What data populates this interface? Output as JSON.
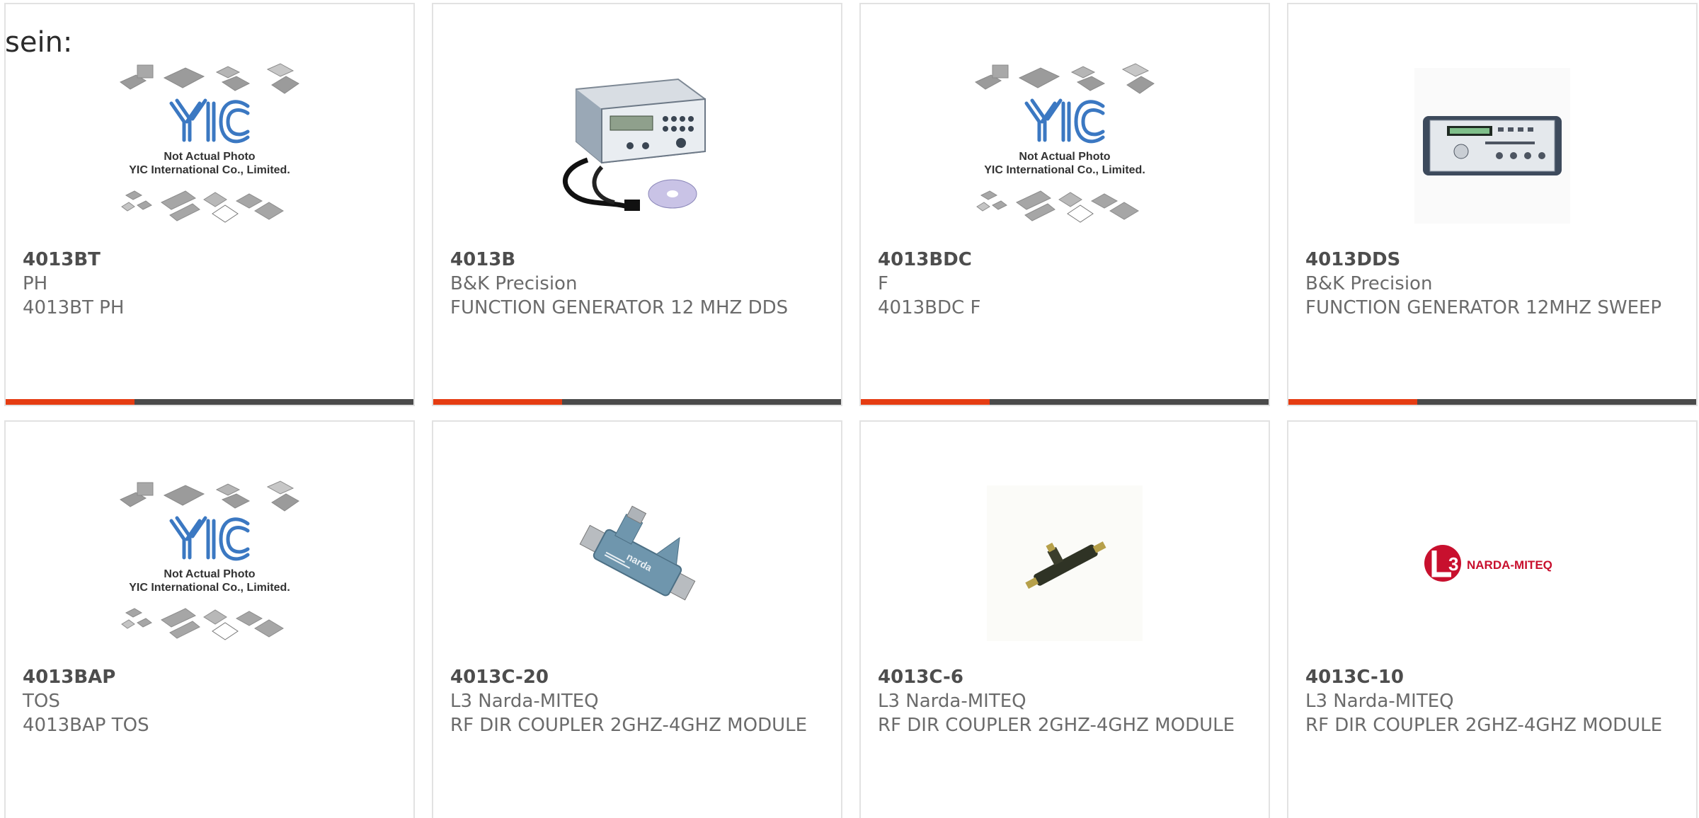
{
  "heading": "sein:",
  "colors": {
    "accent": "#e53c12",
    "bar": "#4a4a4a",
    "border": "#e2e2e2"
  },
  "products": [
    {
      "part_number": "4013BT",
      "manufacturer": "PH",
      "description": "4013BT PH",
      "image": "yic-not-actual-photo",
      "image_caption_1": "Not Actual Photo",
      "image_caption_2": "YIC International Co., Limited."
    },
    {
      "part_number": "4013B",
      "manufacturer": "B&K Precision",
      "description": "FUNCTION GENERATOR 12 MHZ DDS",
      "image": "function-generator-with-cable-and-cd"
    },
    {
      "part_number": "4013BDC",
      "manufacturer": "F",
      "description": "4013BDC F",
      "image": "yic-not-actual-photo",
      "image_caption_1": "Not Actual Photo",
      "image_caption_2": "YIC International Co., Limited."
    },
    {
      "part_number": "4013DDS",
      "manufacturer": "B&K Precision",
      "description": "FUNCTION GENERATOR 12MHZ SWEEP",
      "image": "function-generator-front"
    },
    {
      "part_number": "4013BAP",
      "manufacturer": "TOS",
      "description": "4013BAP TOS",
      "image": "yic-not-actual-photo",
      "image_caption_1": "Not Actual Photo",
      "image_caption_2": "YIC International Co., Limited."
    },
    {
      "part_number": "4013C-20",
      "manufacturer": "L3 Narda-MITEQ",
      "description": "RF DIR COUPLER 2GHZ-4GHZ MODULE",
      "image": "narda-directional-coupler",
      "image_caption_1": "narda"
    },
    {
      "part_number": "4013C-6",
      "manufacturer": "L3 Narda-MITEQ",
      "description": "RF DIR COUPLER 2GHZ-4GHZ MODULE",
      "image": "small-directional-coupler"
    },
    {
      "part_number": "4013C-10",
      "manufacturer": "L3 Narda-MITEQ",
      "description": "RF DIR COUPLER 2GHZ-4GHZ MODULE",
      "image": "l3-narda-miteq-logo",
      "image_caption_1": "NARDA-MITEQ",
      "image_caption_2": "L3"
    }
  ]
}
